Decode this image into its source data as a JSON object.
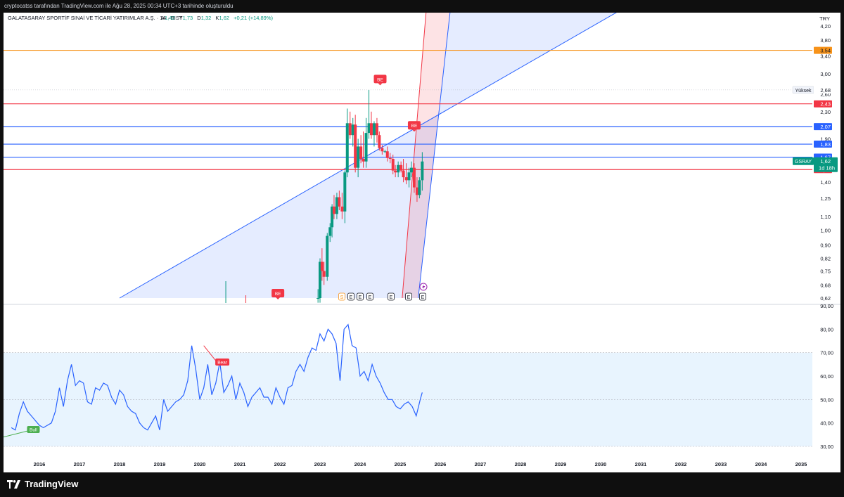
{
  "header": {
    "attribution": "cryptocatss tarafından TradingView.com ile Ağu 28, 2025 00:34 UTC+3 tarihinde oluşturuldu"
  },
  "footer": {
    "brand": "TradingView"
  },
  "chart_data": [
    {
      "type": "candlestick",
      "title": "GALATASARAY SPORTİF SINAİ VE TİCARİ YATIRIMLAR A.Ş. · 1A · BIST",
      "ohlc_labels": {
        "a_label": "A",
        "a": "1,42",
        "y_label": "Y",
        "y": "1,73",
        "d_label": "D",
        "d": "1,32",
        "k_label": "K",
        "k": "1,62",
        "change": "+0,21 (+14,89%)"
      },
      "currency": "TRY",
      "scale": "log",
      "y_ticks": [
        "4,20",
        "3,80",
        "3,40",
        "3,00",
        "2,60",
        "2,30",
        "1,90",
        "1,60",
        "1,40",
        "1,25",
        "1,10",
        "1,00",
        "0,90",
        "0,82",
        "0,75",
        "0,68",
        "0,62"
      ],
      "y_tick_values": [
        4.2,
        3.8,
        3.4,
        3.0,
        2.6,
        2.3,
        1.9,
        1.6,
        1.4,
        1.25,
        1.1,
        1.0,
        0.9,
        0.82,
        0.75,
        0.68,
        0.62
      ],
      "x_ticks": [
        "2016",
        "2017",
        "2018",
        "2019",
        "2020",
        "2021",
        "2022",
        "2023",
        "2024",
        "2025",
        "2026",
        "2027",
        "2028",
        "2029",
        "2030",
        "2031",
        "2032",
        "2033",
        "2034",
        "2035"
      ],
      "symbol_tag": {
        "name": "GSRAY",
        "price": "1,62",
        "countdown": "1d 18h"
      },
      "high_tag": {
        "label": "Yüksek",
        "value": "2,68"
      },
      "horizontal_levels": [
        {
          "value": 3.54,
          "label": "3,54",
          "color": "#f7931a"
        },
        {
          "value": 2.43,
          "label": "2,43",
          "color": "#f23645"
        },
        {
          "value": 2.07,
          "label": "2,07",
          "color": "#2962ff"
        },
        {
          "value": 1.83,
          "label": "1,83",
          "color": "#2962ff"
        },
        {
          "value": 1.67,
          "label": "1,67",
          "color": "#2962ff"
        },
        {
          "value": 1.53,
          "label": "1,53",
          "color": "#f23645"
        }
      ],
      "candles": [
        {
          "t": 2022.95,
          "o": 0.62,
          "h": 0.66,
          "l": 0.6,
          "c": 0.62
        },
        {
          "t": 2023.0,
          "o": 0.62,
          "h": 0.82,
          "l": 0.6,
          "c": 0.8
        },
        {
          "t": 2023.05,
          "o": 0.8,
          "h": 0.88,
          "l": 0.7,
          "c": 0.75
        },
        {
          "t": 2023.1,
          "o": 0.75,
          "h": 0.8,
          "l": 0.68,
          "c": 0.72
        },
        {
          "t": 2023.18,
          "o": 0.72,
          "h": 0.98,
          "l": 0.7,
          "c": 0.96
        },
        {
          "t": 2023.25,
          "o": 0.96,
          "h": 1.05,
          "l": 0.92,
          "c": 1.02
        },
        {
          "t": 2023.3,
          "o": 1.02,
          "h": 1.2,
          "l": 0.95,
          "c": 1.18
        },
        {
          "t": 2023.35,
          "o": 1.18,
          "h": 1.28,
          "l": 1.08,
          "c": 1.12
        },
        {
          "t": 2023.42,
          "o": 1.12,
          "h": 1.3,
          "l": 1.08,
          "c": 1.26
        },
        {
          "t": 2023.48,
          "o": 1.26,
          "h": 1.32,
          "l": 1.15,
          "c": 1.18
        },
        {
          "t": 2023.55,
          "o": 1.18,
          "h": 1.3,
          "l": 1.08,
          "c": 1.14
        },
        {
          "t": 2023.62,
          "o": 1.14,
          "h": 1.52,
          "l": 1.05,
          "c": 1.5
        },
        {
          "t": 2023.68,
          "o": 1.5,
          "h": 2.35,
          "l": 1.45,
          "c": 2.12
        },
        {
          "t": 2023.75,
          "o": 2.12,
          "h": 2.3,
          "l": 1.9,
          "c": 1.95
        },
        {
          "t": 2023.82,
          "o": 1.95,
          "h": 2.2,
          "l": 1.8,
          "c": 2.1
        },
        {
          "t": 2023.88,
          "o": 2.1,
          "h": 2.25,
          "l": 1.5,
          "c": 1.55
        },
        {
          "t": 2023.95,
          "o": 1.55,
          "h": 1.9,
          "l": 1.45,
          "c": 1.8
        },
        {
          "t": 2024.02,
          "o": 1.8,
          "h": 1.95,
          "l": 1.6,
          "c": 1.65
        },
        {
          "t": 2024.08,
          "o": 1.65,
          "h": 2.0,
          "l": 1.55,
          "c": 1.62
        },
        {
          "t": 2024.15,
          "o": 1.62,
          "h": 2.2,
          "l": 1.55,
          "c": 1.98
        },
        {
          "t": 2024.22,
          "o": 1.98,
          "h": 2.68,
          "l": 1.9,
          "c": 2.12
        },
        {
          "t": 2024.28,
          "o": 2.12,
          "h": 2.3,
          "l": 1.9,
          "c": 1.95
        },
        {
          "t": 2024.35,
          "o": 1.95,
          "h": 2.15,
          "l": 1.8,
          "c": 2.12
        },
        {
          "t": 2024.42,
          "o": 2.12,
          "h": 2.2,
          "l": 1.85,
          "c": 1.95
        },
        {
          "t": 2024.48,
          "o": 1.95,
          "h": 2.0,
          "l": 1.75,
          "c": 1.78
        },
        {
          "t": 2024.55,
          "o": 1.78,
          "h": 1.82,
          "l": 1.7,
          "c": 1.74
        },
        {
          "t": 2024.62,
          "o": 1.74,
          "h": 1.76,
          "l": 1.72,
          "c": 1.74
        },
        {
          "t": 2024.68,
          "o": 1.74,
          "h": 1.8,
          "l": 1.62,
          "c": 1.66
        },
        {
          "t": 2024.75,
          "o": 1.66,
          "h": 1.72,
          "l": 1.6,
          "c": 1.65
        },
        {
          "t": 2024.82,
          "o": 1.65,
          "h": 1.7,
          "l": 1.48,
          "c": 1.52
        },
        {
          "t": 2024.88,
          "o": 1.52,
          "h": 1.58,
          "l": 1.45,
          "c": 1.5
        },
        {
          "t": 2024.95,
          "o": 1.5,
          "h": 1.62,
          "l": 1.45,
          "c": 1.58
        },
        {
          "t": 2025.02,
          "o": 1.58,
          "h": 1.62,
          "l": 1.5,
          "c": 1.52
        },
        {
          "t": 2025.08,
          "o": 1.52,
          "h": 1.65,
          "l": 1.4,
          "c": 1.45
        },
        {
          "t": 2025.15,
          "o": 1.45,
          "h": 1.6,
          "l": 1.38,
          "c": 1.42
        },
        {
          "t": 2025.22,
          "o": 1.42,
          "h": 1.55,
          "l": 1.35,
          "c": 1.5
        },
        {
          "t": 2025.28,
          "o": 1.5,
          "h": 1.62,
          "l": 1.45,
          "c": 1.55
        },
        {
          "t": 2025.35,
          "o": 1.55,
          "h": 1.6,
          "l": 1.3,
          "c": 1.35
        },
        {
          "t": 2025.42,
          "o": 1.35,
          "h": 1.45,
          "l": 1.22,
          "c": 1.28
        },
        {
          "t": 2025.48,
          "o": 1.28,
          "h": 1.45,
          "l": 1.25,
          "c": 1.42
        },
        {
          "t": 2025.55,
          "o": 1.42,
          "h": 1.73,
          "l": 1.32,
          "c": 1.62
        }
      ],
      "markers": [
        {
          "t": 2021.95,
          "label": "BE",
          "at": "bottom"
        },
        {
          "t": 2024.5,
          "label": "BE",
          "value": 2.7
        },
        {
          "t": 2025.35,
          "label": "BE",
          "value": 1.95
        }
      ],
      "event_icons": [
        "S",
        "E",
        "E",
        "E",
        "E",
        "E",
        "E"
      ],
      "channels": [
        {
          "name": "upper-fan",
          "points": [
            [
              2018.0,
              0.62
            ],
            [
              2030.5,
              4.7
            ]
          ],
          "color": "#2962ff"
        },
        {
          "name": "steep-red",
          "points": [
            [
              2025.05,
              0.62
            ],
            [
              2025.65,
              4.7
            ]
          ],
          "color": "#f23645"
        },
        {
          "name": "steep-blue",
          "points": [
            [
              2025.45,
              0.62
            ],
            [
              2026.25,
              4.7
            ]
          ],
          "color": "#2962ff"
        }
      ]
    },
    {
      "type": "line",
      "name": "RSI",
      "y_ticks": [
        "90,00",
        "80,00",
        "70,00",
        "60,00",
        "50,00",
        "40,00",
        "30,00"
      ],
      "y_tick_values": [
        90,
        80,
        70,
        60,
        50,
        40,
        30
      ],
      "band": [
        30,
        70
      ],
      "midline": 50,
      "x": [
        2015.3,
        2015.4,
        2015.5,
        2015.6,
        2015.7,
        2015.8,
        2015.9,
        2016.0,
        2016.1,
        2016.2,
        2016.3,
        2016.4,
        2016.5,
        2016.6,
        2016.7,
        2016.8,
        2016.9,
        2017.0,
        2017.1,
        2017.2,
        2017.3,
        2017.4,
        2017.5,
        2017.6,
        2017.7,
        2017.8,
        2017.9,
        2018.0,
        2018.1,
        2018.2,
        2018.3,
        2018.4,
        2018.5,
        2018.6,
        2018.7,
        2018.8,
        2018.9,
        2019.0,
        2019.1,
        2019.2,
        2019.3,
        2019.4,
        2019.5,
        2019.6,
        2019.7,
        2019.8,
        2019.9,
        2020.0,
        2020.1,
        2020.2,
        2020.3,
        2020.4,
        2020.5,
        2020.6,
        2020.7,
        2020.8,
        2020.9,
        2021.0,
        2021.1,
        2021.2,
        2021.3,
        2021.4,
        2021.5,
        2021.6,
        2021.7,
        2021.8,
        2021.9,
        2022.0,
        2022.1,
        2022.2,
        2022.3,
        2022.4,
        2022.5,
        2022.6,
        2022.7,
        2022.8,
        2022.9,
        2023.0,
        2023.1,
        2023.2,
        2023.3,
        2023.4,
        2023.5,
        2023.6,
        2023.7,
        2023.8,
        2023.9,
        2024.0,
        2024.1,
        2024.2,
        2024.3,
        2024.4,
        2024.5,
        2024.6,
        2024.7,
        2024.8,
        2024.9,
        2025.0,
        2025.1,
        2025.2,
        2025.3,
        2025.4,
        2025.5,
        2025.55
      ],
      "y": [
        38,
        37,
        44,
        49,
        45,
        43,
        41,
        39,
        38,
        39,
        40,
        45,
        55,
        47,
        58,
        65,
        56,
        58,
        57,
        49,
        48,
        55,
        54,
        57,
        56,
        51,
        48,
        54,
        52,
        47,
        45,
        44,
        40,
        38,
        37,
        40,
        43,
        37,
        50,
        45,
        47,
        49,
        50,
        52,
        58,
        73,
        63,
        50,
        55,
        65,
        52,
        57,
        66,
        53,
        56,
        60,
        50,
        57,
        53,
        47,
        51,
        53,
        55,
        51,
        51,
        48,
        55,
        51,
        48,
        55,
        56,
        62,
        65,
        62,
        68,
        72,
        71,
        78,
        75,
        80,
        78,
        74,
        58,
        80,
        82,
        73,
        72,
        60,
        62,
        58,
        65,
        60,
        57,
        53,
        50,
        50,
        47,
        46,
        48,
        49,
        47,
        43,
        50,
        53
      ],
      "signals": [
        {
          "label": "Bull",
          "x": 2015.85,
          "y": 39
        },
        {
          "label": "Bear",
          "x": 2020.3,
          "y": 66
        }
      ]
    }
  ]
}
